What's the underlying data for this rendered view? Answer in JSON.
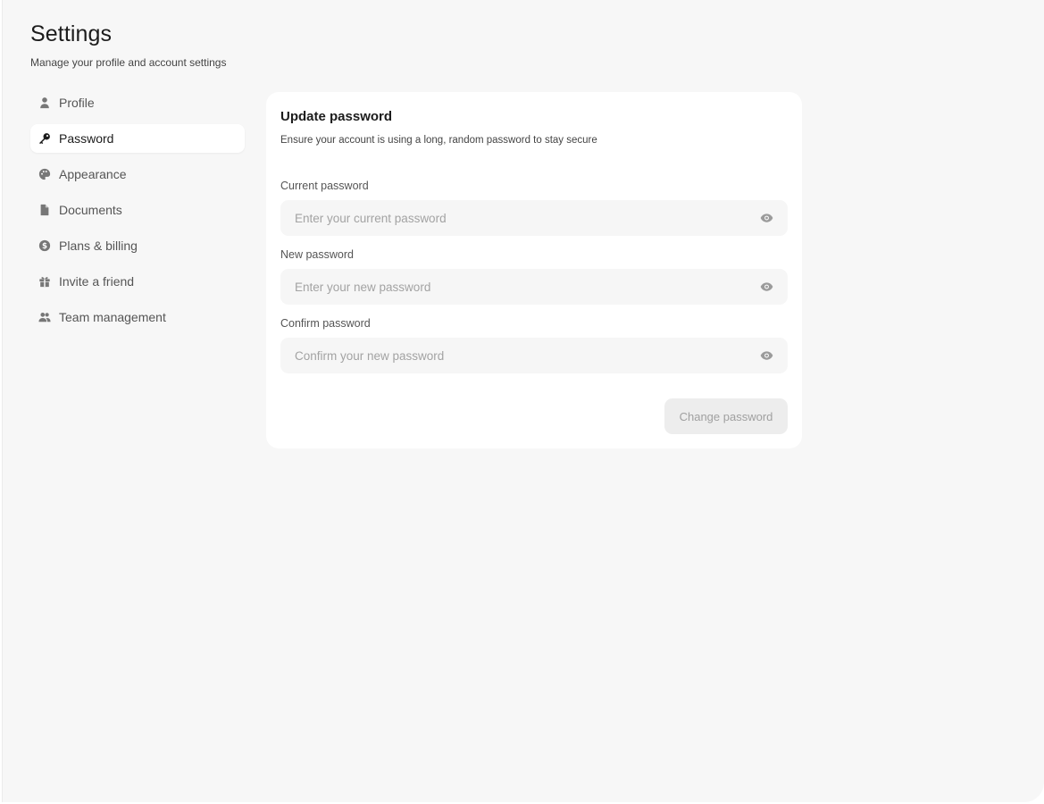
{
  "header": {
    "title": "Settings",
    "subtitle": "Manage your profile and account settings"
  },
  "sidebar": {
    "items": [
      {
        "label": "Profile",
        "icon": "user-icon",
        "active": false
      },
      {
        "label": "Password",
        "icon": "key-icon",
        "active": true
      },
      {
        "label": "Appearance",
        "icon": "palette-icon",
        "active": false
      },
      {
        "label": "Documents",
        "icon": "document-icon",
        "active": false
      },
      {
        "label": "Plans & billing",
        "icon": "dollar-circle-icon",
        "active": false
      },
      {
        "label": "Invite a friend",
        "icon": "gift-icon",
        "active": false
      },
      {
        "label": "Team management",
        "icon": "users-icon",
        "active": false
      }
    ]
  },
  "card": {
    "title": "Update password",
    "description": "Ensure your account is using a long, random password to stay secure",
    "fields": [
      {
        "label": "Current password",
        "placeholder": "Enter your current password",
        "value": ""
      },
      {
        "label": "New password",
        "placeholder": "Enter your new password",
        "value": ""
      },
      {
        "label": "Confirm password",
        "placeholder": "Confirm your new password",
        "value": ""
      }
    ],
    "submit_label": "Change password",
    "submit_disabled": true
  },
  "colors": {
    "background": "#f7f7f7",
    "card": "#ffffff",
    "field": "#f6f6f6",
    "button_disabled": "#ededed"
  }
}
